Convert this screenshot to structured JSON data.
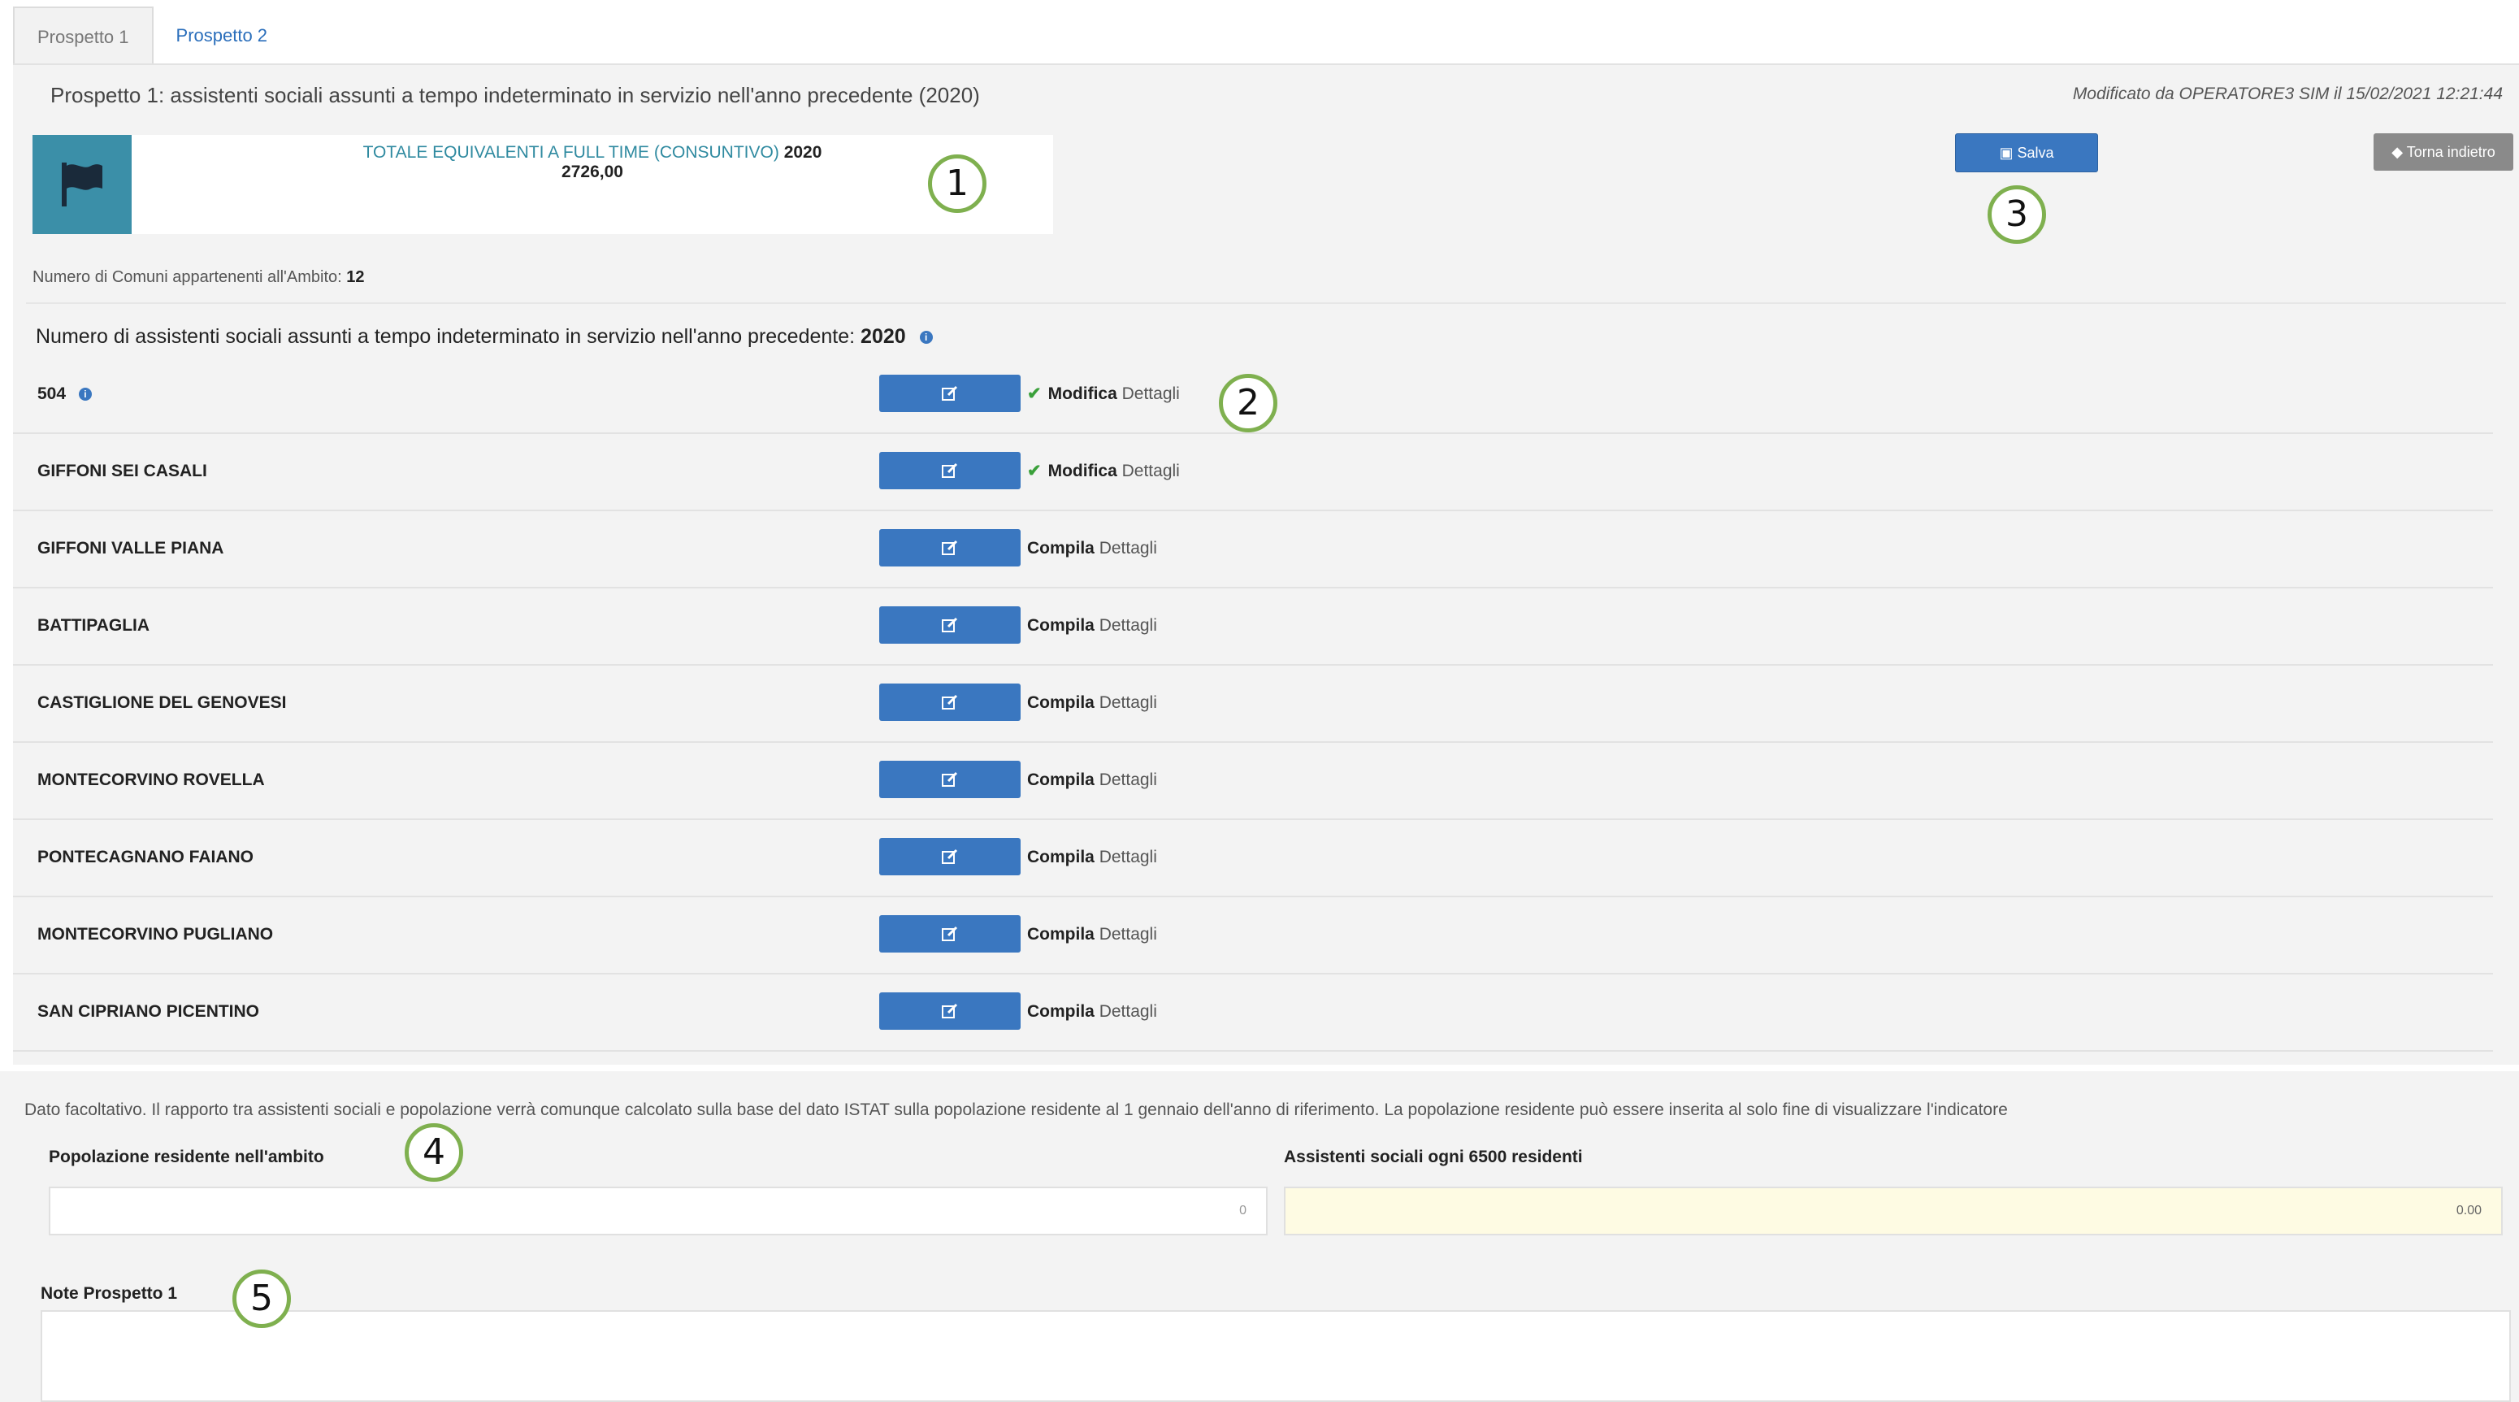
{
  "tabs": [
    {
      "label": "Prospetto 1",
      "active": true
    },
    {
      "label": "Prospetto 2",
      "active": false
    }
  ],
  "header": {
    "title": "Prospetto 1: assistenti sociali assunti a tempo indeterminato in servizio nell'anno precedente (2020)",
    "modified": "Modificato da OPERATORE3 SIM il 15/02/2021 12:21:44"
  },
  "totale": {
    "label": "TOTALE EQUIVALENTI A FULL TIME (CONSUNTIVO)",
    "year": "2020",
    "value": "2726,00"
  },
  "buttons": {
    "save": "Salva",
    "back": "Torna indietro"
  },
  "comuni": {
    "label": "Numero di Comuni appartenenti all'Ambito:",
    "count": "12"
  },
  "section": {
    "label": "Numero di assistenti sociali assunti a tempo indeterminato in servizio nell'anno precedente:",
    "year": "2020"
  },
  "rows": [
    {
      "name": "504",
      "action": "Modifica",
      "details": "Dettagli"
    },
    {
      "name": "GIFFONI SEI CASALI",
      "action": "Modifica",
      "details": "Dettagli"
    },
    {
      "name": "GIFFONI VALLE PIANA",
      "action": "Compila",
      "details": "Dettagli"
    },
    {
      "name": "BATTIPAGLIA",
      "action": "Compila",
      "details": "Dettagli"
    },
    {
      "name": "CASTIGLIONE DEL GENOVESI",
      "action": "Compila",
      "details": "Dettagli"
    },
    {
      "name": "MONTECORVINO ROVELLA",
      "action": "Compila",
      "details": "Dettagli"
    },
    {
      "name": "PONTECAGNANO FAIANO",
      "action": "Compila",
      "details": "Dettagli"
    },
    {
      "name": "MONTECORVINO PUGLIANO",
      "action": "Compila",
      "details": "Dettagli"
    },
    {
      "name": "SAN CIPRIANO PICENTINO",
      "action": "Compila",
      "details": "Dettagli"
    }
  ],
  "lower": {
    "note": "Dato facoltativo. Il rapporto tra assistenti sociali e popolazione verrà comunque calcolato sulla base del dato ISTAT sulla popolazione residente al 1 gennaio dell'anno di riferimento. La popolazione residente può essere inserita al solo fine di visualizzare l'indicatore",
    "popolazione_label": "Popolazione residente nell'ambito",
    "popolazione_value": "0",
    "assistenti_label": "Assistenti sociali ogni 6500 residenti",
    "assistenti_value": "0.00",
    "note_label": "Note Prospetto 1"
  },
  "callouts": [
    "1",
    "2",
    "3",
    "4",
    "5"
  ],
  "colors": {
    "accent": "#3a77c0",
    "flag_bg": "#3b8fa8",
    "callout_ring": "#7fb04f"
  }
}
